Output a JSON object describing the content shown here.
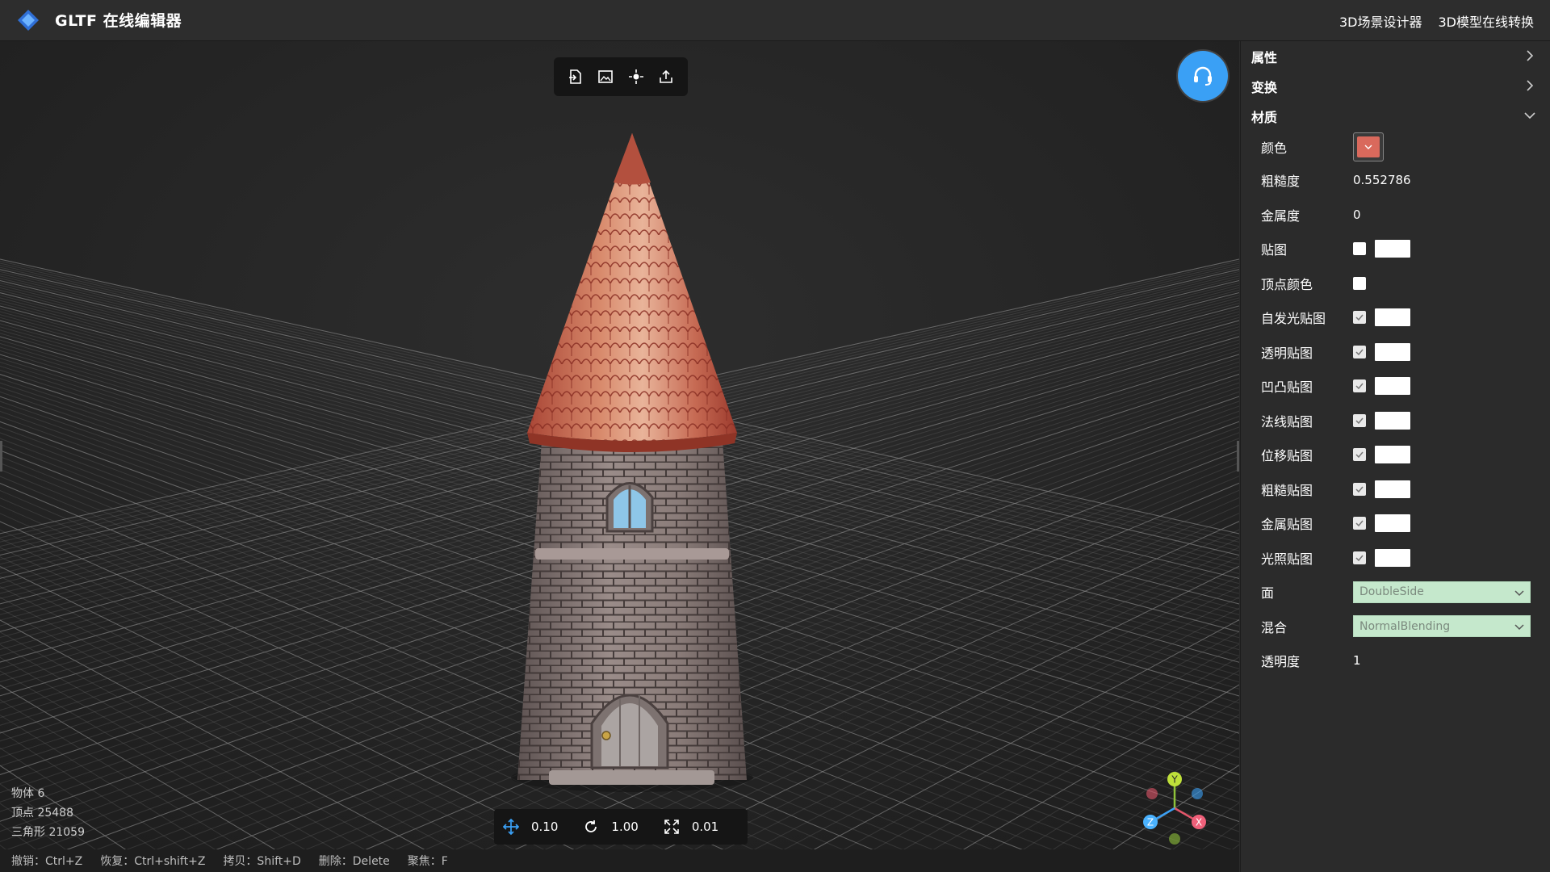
{
  "app": {
    "title": "GLTF 在线编辑器"
  },
  "nav": {
    "links": [
      "3D场景设计器",
      "3D模型在线转换"
    ]
  },
  "stats": {
    "objects": "物体 6",
    "vertices": "顶点 25488",
    "triangles": "三角形 21059"
  },
  "transform": {
    "move": "0.10",
    "rotate": "1.00",
    "scale": "0.01"
  },
  "shortcuts": [
    "撤销：Ctrl+Z",
    "恢复：Ctrl+shift+Z",
    "拷贝：Shift+D",
    "删除：Delete",
    "聚焦：F"
  ],
  "gizmo": {
    "x": "X",
    "y": "Y",
    "z": "Z"
  },
  "panel": {
    "sections": {
      "properties": "属性",
      "transform": "变换",
      "material": "材质"
    },
    "material": {
      "color_label": "颜色",
      "color_value": "#d9695c",
      "roughness_label": "粗糙度",
      "roughness_value": "0.552786",
      "metalness_label": "金属度",
      "metalness_value": "0",
      "map_label": "贴图",
      "vertex_colors_label": "顶点颜色",
      "emissive_map_label": "自发光贴图",
      "alpha_map_label": "透明贴图",
      "bump_map_label": "凹凸贴图",
      "normal_map_label": "法线贴图",
      "displacement_map_label": "位移贴图",
      "roughness_map_label": "粗糙贴图",
      "metalness_map_label": "金属贴图",
      "light_map_label": "光照贴图",
      "side_label": "面",
      "side_value": "DoubleSide",
      "blending_label": "混合",
      "blending_value": "NormalBlending",
      "opacity_label": "透明度",
      "opacity_value": "1"
    }
  },
  "colors": {
    "accent": "#3aa0f5",
    "roof": "#c8634f",
    "stone": "#8b7e7a",
    "select_bg": "#c5e8cc"
  }
}
